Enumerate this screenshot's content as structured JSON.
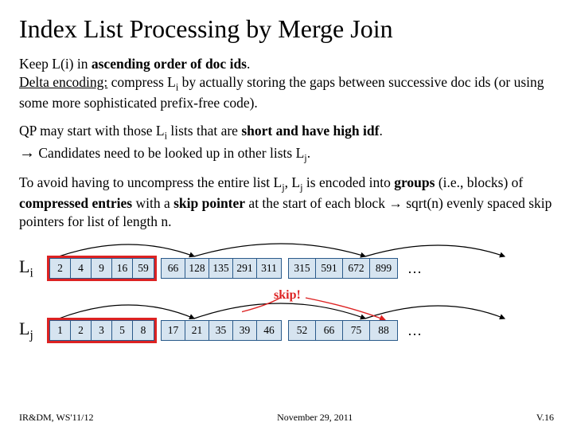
{
  "title": "Index List Processing by Merge Join",
  "para1_a": "Keep L(i) in ",
  "para1_b": "ascending order of doc ids",
  "para1_c": ".",
  "para1_d": "Delta encoding:",
  "para1_e": " compress L",
  "para1_f": "i",
  "para1_g": " by actually storing the gaps between successive doc ids (or using some more sophisticated prefix-free code).",
  "para2_a": "QP may start with those L",
  "para2_sub": "i",
  "para2_b": " lists that are ",
  "para2_c": "short and have high idf",
  "para2_d": ".",
  "para2_e": "→",
  "para2_f": " Candidates need to be looked up in other lists L",
  "para2_subj": "j",
  "para2_g": ".",
  "para3_a": "To avoid having to uncompress the entire list L",
  "para3_b": ", L",
  "para3_c": " is encoded into ",
  "para3_d": "groups",
  "para3_e": " (i.e., blocks) of ",
  "para3_f": "compressed entries",
  "para3_g": " with a ",
  "para3_h": "skip pointer",
  "para3_i": " at the start of each block → sqrt(n) evenly spaced skip pointers for list of length n.",
  "label_li_a": "L",
  "label_li_b": "i",
  "label_lj_a": "L",
  "label_lj_b": "j",
  "li_g1": [
    "2",
    "4",
    "9",
    "16",
    "59"
  ],
  "li_g2": [
    "66",
    "128",
    "135",
    "291",
    "311"
  ],
  "li_g3": [
    "315",
    "591",
    "672",
    "899"
  ],
  "lj_g1": [
    "1",
    "2",
    "3",
    "5",
    "8"
  ],
  "lj_g2": [
    "17",
    "21",
    "35",
    "39",
    "46"
  ],
  "lj_g3": [
    "52",
    "66",
    "75",
    "88"
  ],
  "dots": "…",
  "skip": "skip!",
  "footer_left": "IR&DM, WS'11/12",
  "footer_mid": "November 29, 2011",
  "footer_right": "V.16"
}
